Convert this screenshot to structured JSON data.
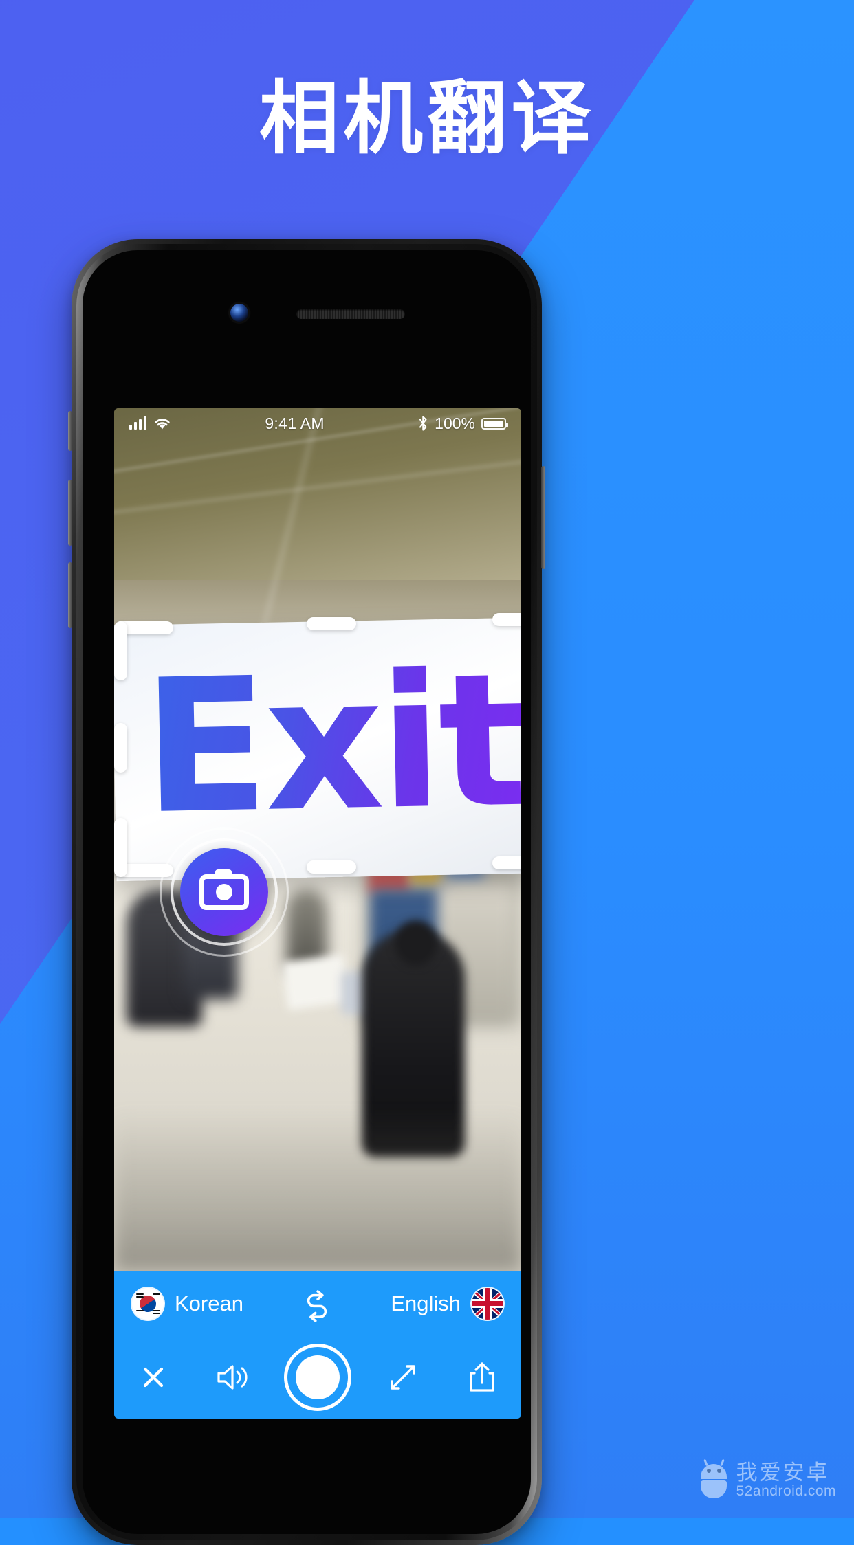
{
  "page": {
    "title": "相机翻译",
    "bg_color_primary": "#2a8dff",
    "bg_color_secondary": "#4a66f1"
  },
  "phone": {
    "status_bar": {
      "signal_icon": "cellular-bars-icon",
      "wifi_icon": "wifi-icon",
      "time": "9:41 AM",
      "bluetooth_icon": "bluetooth-icon",
      "battery_percent": "100%",
      "battery_icon": "battery-full-icon"
    }
  },
  "camera": {
    "detected_sign_text": "Exit",
    "sign_gradient_from": "#3b63e8",
    "sign_gradient_to": "#7a2df0",
    "scan_frame_name": "scan-frame",
    "capture_badge_icon": "camera-icon"
  },
  "language_bar": {
    "source": {
      "flag": "korea-flag-icon",
      "label": "Korean"
    },
    "swap_icon": "swap-languages-icon",
    "target": {
      "flag": "uk-flag-icon",
      "label": "English"
    },
    "bar_color": "#1e9bfb"
  },
  "toolbar": {
    "items": [
      {
        "name": "close-button",
        "icon": "close-x-icon"
      },
      {
        "name": "speaker-button",
        "icon": "speaker-sound-icon"
      },
      {
        "name": "shutter-button",
        "icon": "shutter-circle-icon"
      },
      {
        "name": "expand-button",
        "icon": "expand-arrows-icon"
      },
      {
        "name": "share-button",
        "icon": "share-upload-icon"
      }
    ]
  },
  "watermark": {
    "robot_icon": "android-robot-icon",
    "chinese": "我爱安卓",
    "url": "52android.com"
  }
}
